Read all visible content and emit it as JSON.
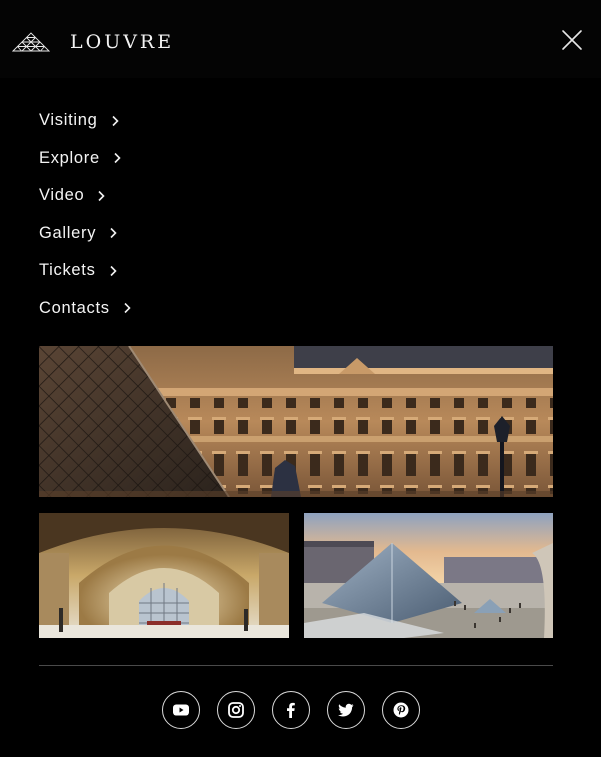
{
  "brand": {
    "name": "LOUVRE",
    "logo_icon": "pyramid-icon"
  },
  "header": {
    "close_icon": "close-icon"
  },
  "nav": {
    "items": [
      {
        "label": "Visiting",
        "icon": "chevron-right-icon"
      },
      {
        "label": "Explore",
        "icon": "chevron-right-icon"
      },
      {
        "label": "Video",
        "icon": "chevron-right-icon"
      },
      {
        "label": "Gallery",
        "icon": "chevron-right-icon"
      },
      {
        "label": "Tickets",
        "icon": "chevron-right-icon"
      },
      {
        "label": "Contacts",
        "icon": "chevron-right-icon"
      }
    ]
  },
  "gallery": {
    "photos": [
      "louvre-facade-with-pyramid-photo",
      "palace-gallery-interior-photo",
      "pyramid-courtyard-sunset-photo"
    ]
  },
  "social": {
    "icons": [
      "youtube-icon",
      "instagram-icon",
      "facebook-icon",
      "twitter-icon",
      "pinterest-icon"
    ]
  },
  "colors": {
    "background": "#000000",
    "header": "#040404",
    "text": "#ffffff",
    "divider": "#4a4a4a",
    "page": "#ffffff"
  }
}
